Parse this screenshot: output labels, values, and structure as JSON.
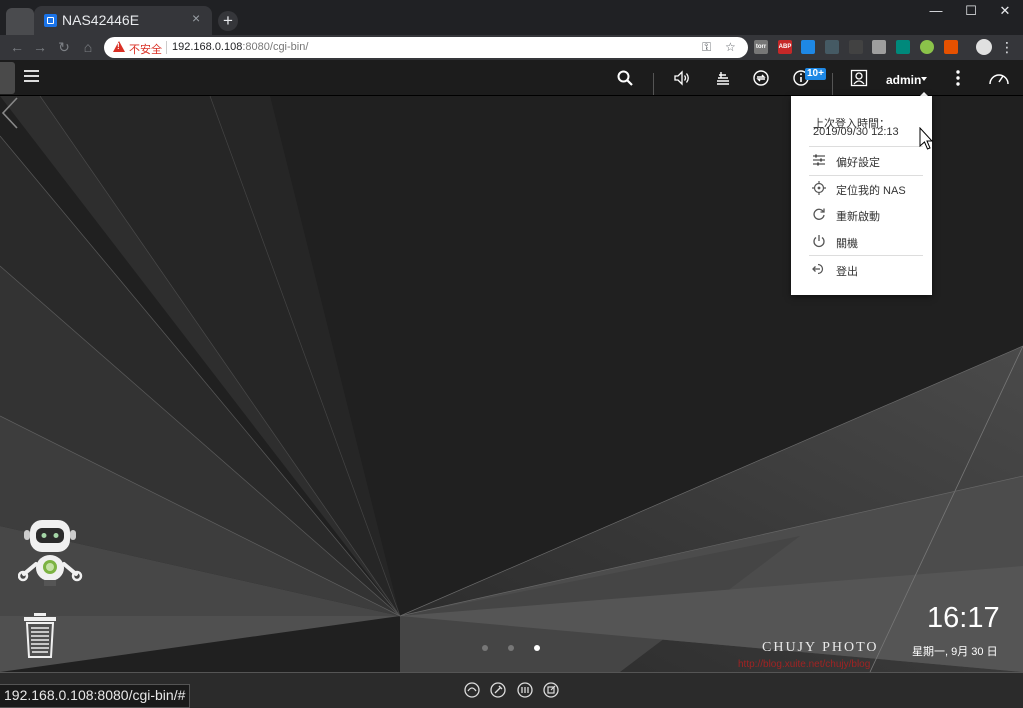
{
  "browser": {
    "tab_title": "NAS42446E",
    "tab_close": "×",
    "new_tab": "+",
    "security_label": "不安全",
    "url_host": "192.168.0.108",
    "url_rest": ":8080/cgi-bin/",
    "status_url": "192.168.0.108:8080/cgi-bin/#",
    "extensions": [
      "torr",
      "ABP"
    ],
    "window_controls": [
      "—",
      "☐",
      "✕"
    ]
  },
  "topbar": {
    "notification_badge": "10+",
    "user": "admin"
  },
  "user_menu": {
    "last_login_label": "上次登入時間：",
    "last_login_time": "2019/09/30 12:13",
    "items": [
      {
        "label": "偏好設定",
        "icon": "preferences-icon"
      },
      {
        "label": "定位我的 NAS",
        "icon": "locate-icon"
      },
      {
        "label": "重新啟動",
        "icon": "restart-icon"
      },
      {
        "label": "關機",
        "icon": "power-icon"
      },
      {
        "label": "登出",
        "icon": "logout-icon"
      }
    ]
  },
  "desktop": {
    "time": "16:17",
    "date": "星期一, 9月 30 日",
    "watermark": "CHUJY PHOTO",
    "watermark_url": "http://blog.xuite.net/chujy/blog",
    "pages": 3,
    "active_page": 3
  },
  "colors": {
    "badge": "#1e88e5",
    "security_warning": "#d93025",
    "desktop_bg": "#232323"
  }
}
